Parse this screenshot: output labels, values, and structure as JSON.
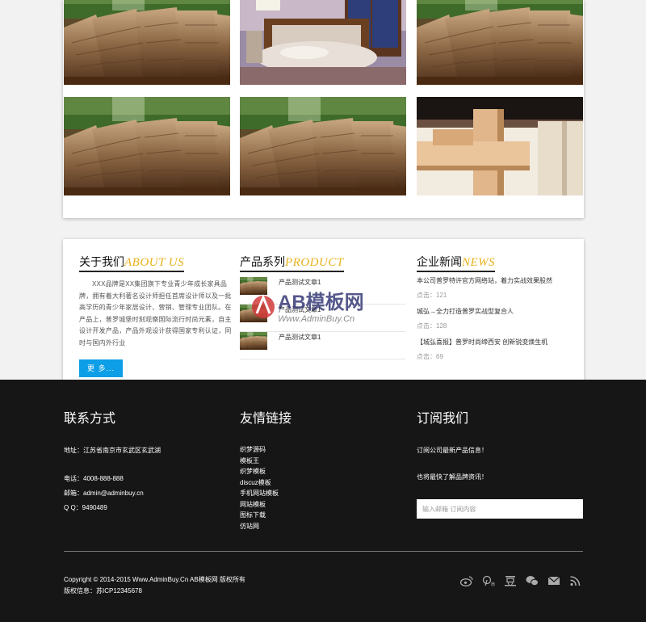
{
  "gallery": {
    "items": [
      {
        "name": "log-stack-photo"
      },
      {
        "name": "bedroom-photo"
      },
      {
        "name": "log-stack-photo"
      },
      {
        "name": "log-stack-photo"
      },
      {
        "name": "log-stack-photo"
      },
      {
        "name": "wood-joint-photo"
      }
    ]
  },
  "about": {
    "title_cn": "关于我们",
    "title_en": "ABOUT US",
    "text": "XXX品牌是XX集团旗下专业青少年成长家具品牌，拥有着大利著名设计师担任首席设计师以及一批高学历的青少年家居设计、营销、管理专业团队。在产品上，普罗城堡时刻观察国际流行时尚元素，自主设计开发产品，产品外观设计获得国家专利认证，同时与国内外行业",
    "more_label": "更 多..."
  },
  "products": {
    "title_cn": "产品系列",
    "title_en": "PRODUCT",
    "items": [
      {
        "label": "产品测试文章1"
      },
      {
        "label": "产品测试文章1"
      },
      {
        "label": "产品测试文章1"
      }
    ]
  },
  "news": {
    "title_cn": "企业新闻",
    "title_en": "NEWS",
    "items": [
      {
        "title": "本公司普罗特许官方网络站，着力实战效果股然",
        "hits": "点击：121"
      },
      {
        "title": "城弘→全力打造普罗实战型复合人",
        "hits": "点击：128"
      },
      {
        "title": "【城弘喜报】普罗时尚缔西安 创新锐变焕生机",
        "hits": "点击：69"
      }
    ]
  },
  "watermark": {
    "logo_text": "AB模板网",
    "url_text": "Www.AdminBuy.Cn"
  },
  "footer": {
    "contact": {
      "title": "联系方式",
      "address": "地址：江苏省南京市玄武区玄武湖",
      "phone": "电话：4008-888-888",
      "email": "邮箱：admin@adminbuy.cn",
      "qq": "Q Q：9490489"
    },
    "links": {
      "title": "友情链接",
      "items": [
        "织梦源码",
        "模板王",
        "织梦模板",
        "discuz模板",
        "手机网站模板",
        "网站模板",
        "图标下载",
        "仿站网"
      ]
    },
    "subscribe": {
      "title": "订阅我们",
      "line1": "订阅公司最新产品信息！",
      "line2": "也将最快了解品牌资讯！",
      "placeholder": "输入邮箱 订阅内容"
    },
    "copyright": "Copyright © 2014-2015 Www.AdminBuy.Cn AB模板网 版权所有",
    "icp": "版权信息：苏ICP12345678",
    "social_icons": [
      "weibo-icon",
      "tencent-weibo-icon",
      "douban-icon",
      "wechat-icon",
      "mail-icon",
      "rss-icon"
    ]
  },
  "colors": {
    "accent_blue": "#0c9ee6",
    "title_gold": "#e8b21b",
    "footer_bg": "#161617"
  }
}
